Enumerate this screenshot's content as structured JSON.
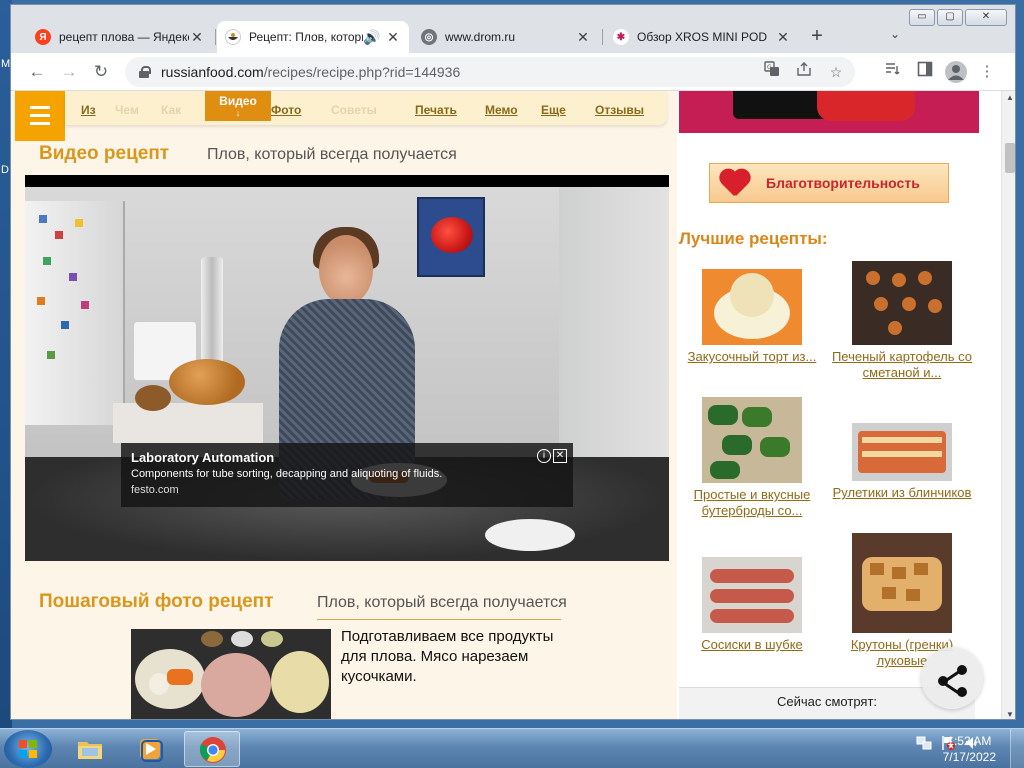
{
  "desktop": {
    "edge_letters": [
      "M",
      "D"
    ]
  },
  "window": {
    "buttons": {
      "minimize": "▭",
      "maximize": "▢",
      "close": "✕"
    }
  },
  "tabs": [
    {
      "title": "рецепт плова — Яндекс",
      "favicon": "yandex",
      "close": "✕"
    },
    {
      "title": "Рецепт: Плов, который",
      "favicon": "russianfood",
      "close": "✕",
      "audio": "🔊",
      "active": true
    },
    {
      "title": "www.drom.ru",
      "favicon": "globe",
      "close": "✕"
    },
    {
      "title": "Обзор XROS MINI POD",
      "favicon": "xros",
      "close": "✕"
    }
  ],
  "toolbar": {
    "back": "←",
    "forward": "→",
    "reload": "↻",
    "new_tab": "+",
    "tab_search": "⌄",
    "url_host": "russianfood.com",
    "url_path": "/recipes/recipe.php?rid=144936",
    "omnibox_icons": [
      "translate-icon",
      "share-icon",
      "bookmark-star-icon"
    ],
    "right_icons": [
      "reading-list-icon",
      "side-panel-icon",
      "profile-icon",
      "menu-icon"
    ]
  },
  "page_nav": {
    "items": [
      {
        "label": "Из",
        "faded": false
      },
      {
        "label": "Чем",
        "faded": true
      },
      {
        "label": "Как",
        "faded": true
      },
      {
        "label": "Видео",
        "active": true
      },
      {
        "label": "Фото",
        "faded": false
      },
      {
        "label": "Советы",
        "faded": true
      },
      {
        "label": "Печать",
        "faded": false
      },
      {
        "label": "Мемо",
        "faded": false
      },
      {
        "label": "Еще",
        "faded": false
      },
      {
        "label": "Отзывы",
        "faded": false
      }
    ],
    "active_arrow": "↓"
  },
  "video_section": {
    "title": "Видео рецепт",
    "subtitle": "Плов, который всегда получается"
  },
  "ad": {
    "title": "Laboratory Automation",
    "description": "Components for tube sorting, decapping and aliquoting of fluids.",
    "url": "festo.com",
    "info": "i",
    "close": "✕"
  },
  "photo_section": {
    "title": "Пошаговый фото рецепт",
    "subtitle": "Плов, который всегда получается",
    "step_text": "Подготавливаем все продукты для плова. Мясо нарезаем кусочками."
  },
  "sidebar": {
    "charity": "Благотворительность",
    "best_title": "Лучшие рецепты:",
    "recipes": [
      {
        "caption": "Закусочный торт из..."
      },
      {
        "caption": "Печеный картофель со сметаной и..."
      },
      {
        "caption": "Простые и вкусные бутерброды со..."
      },
      {
        "caption": "Рулетики из блинчиков"
      },
      {
        "caption": "Сосиски в шубке"
      },
      {
        "caption": "Крутоны (гренки) луковые"
      }
    ],
    "watching": "Сейчас смотрят:"
  },
  "scrollbar": {
    "up": "▲",
    "down": "▼"
  },
  "taskbar": {
    "apps": [
      "explorer",
      "media-player",
      "chrome"
    ],
    "tray_icons": [
      "network-icon",
      "flag-icon",
      "volume-icon"
    ],
    "time": "1:52 AM",
    "date": "7/17/2022"
  },
  "colors": {
    "accent_orange": "#f5a300",
    "title_gold": "#d9971e",
    "link_brown": "#916a16",
    "page_bg": "#fdf5e7"
  }
}
